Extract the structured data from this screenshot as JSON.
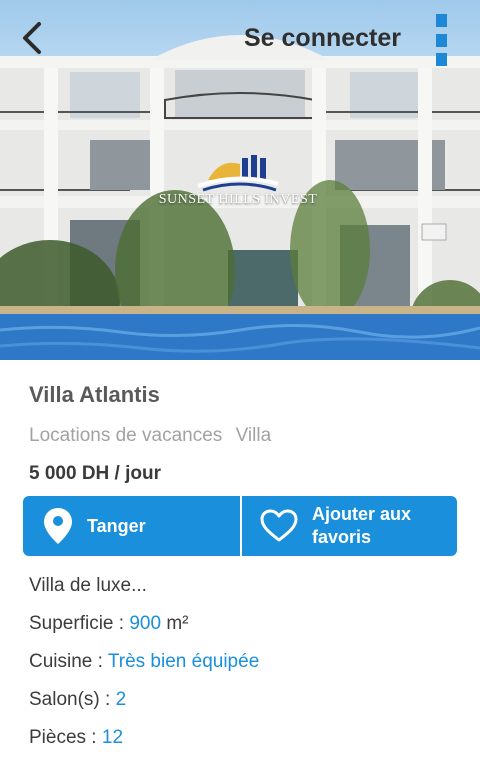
{
  "header": {
    "login_label": "Se connecter",
    "back_icon": "chevron-left-icon",
    "menu_icon": "vertical-dots-menu-icon"
  },
  "hero": {
    "logo_text": "SUNSET HILLS INVEST"
  },
  "listing": {
    "title": "Villa Atlantis",
    "category": "Locations de vacances",
    "type": "Villa",
    "price": "5 000 DH / jour",
    "description": "Villa de luxe..."
  },
  "actions": {
    "location_label": "Tanger",
    "favorite_label_line1": "Ajouter aux",
    "favorite_label_line2": "favoris"
  },
  "attributes": {
    "superficie": {
      "label": "Superficie :",
      "value": "900",
      "unit": "m²"
    },
    "cuisine": {
      "label": "Cuisine :",
      "value": "Très bien équipée"
    },
    "salons": {
      "label": "Salon(s) :",
      "value": "2"
    },
    "pieces": {
      "label": "Pièces :",
      "value": "12"
    }
  },
  "colors": {
    "accent": "#1a8fdb",
    "text": "#3c3c3c",
    "muted": "#a2a2a2"
  }
}
